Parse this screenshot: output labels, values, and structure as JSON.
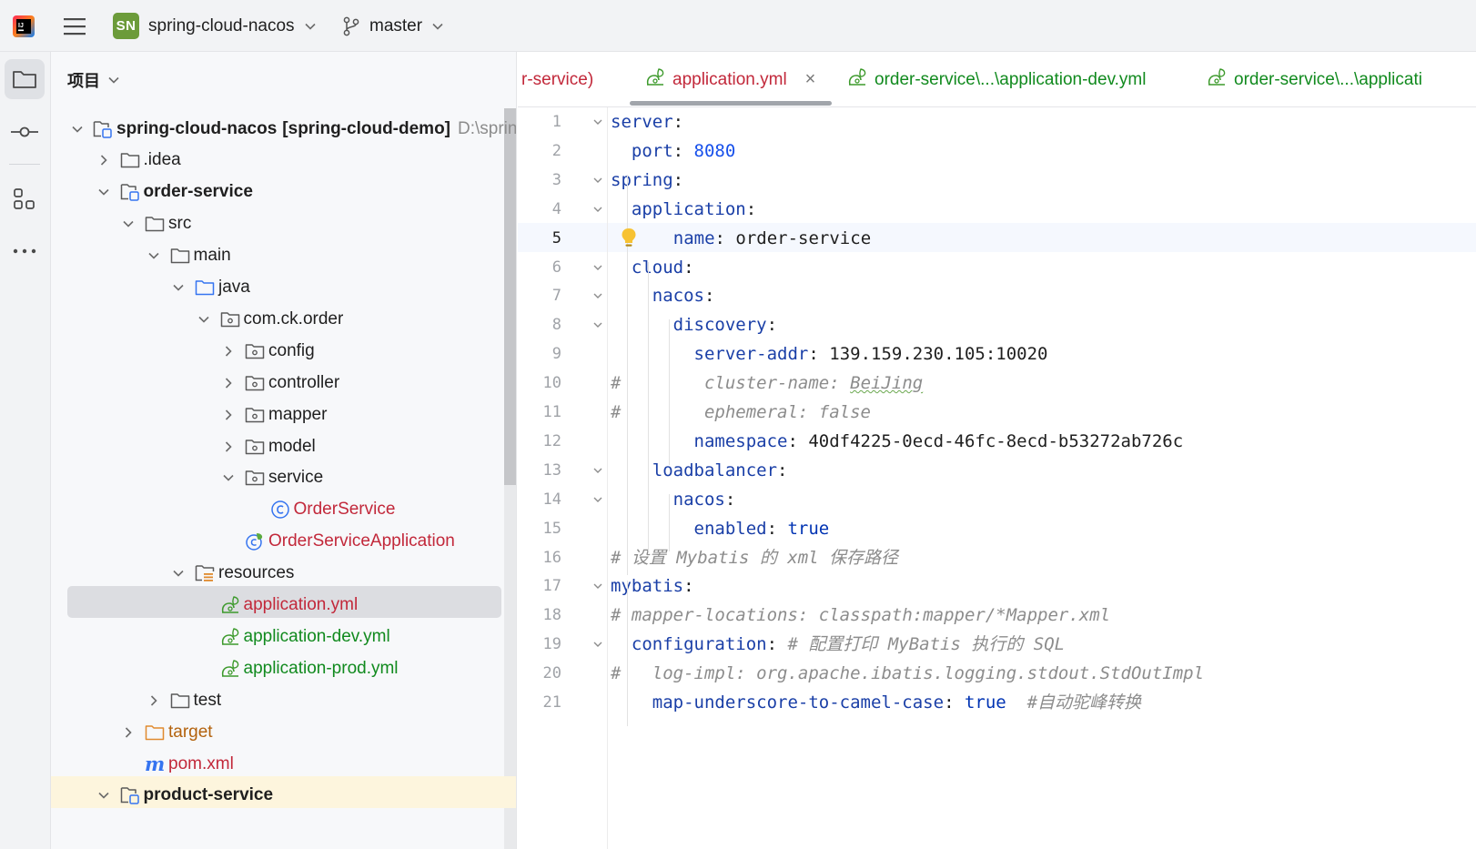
{
  "titlebar": {
    "project_avatar": "SN",
    "project_name": "spring-cloud-nacos",
    "branch": "master"
  },
  "panel": {
    "title": "项目"
  },
  "tree": [
    {
      "label": "spring-cloud-nacos",
      "extra": "[spring-cloud-demo]",
      "path": "D:\\spring",
      "bold": true
    },
    {
      "label": ".idea"
    },
    {
      "label": "order-service",
      "bold": true
    },
    {
      "label": "src"
    },
    {
      "label": "main"
    },
    {
      "label": "java"
    },
    {
      "label": "com.ck.order"
    },
    {
      "label": "config"
    },
    {
      "label": "controller"
    },
    {
      "label": "mapper"
    },
    {
      "label": "model"
    },
    {
      "label": "service"
    },
    {
      "label": "OrderService"
    },
    {
      "label": "OrderServiceApplication"
    },
    {
      "label": "resources"
    },
    {
      "label": "application.yml"
    },
    {
      "label": "application-dev.yml"
    },
    {
      "label": "application-prod.yml"
    },
    {
      "label": "test"
    },
    {
      "label": "target"
    },
    {
      "label": "pom.xml"
    },
    {
      "label": "product-service",
      "bold": true
    }
  ],
  "tabs": [
    {
      "label": "r-service)"
    },
    {
      "label": "application.yml",
      "active": true
    },
    {
      "label": "order-service\\...\\application-dev.yml"
    },
    {
      "label": "order-service\\...\\applicati"
    }
  ],
  "editor": {
    "current_line": 5,
    "lines": [
      {
        "n": "1",
        "key": "server",
        "sep": ":"
      },
      {
        "n": "2",
        "key": "port",
        "sep": ": ",
        "val": "8080"
      },
      {
        "n": "3",
        "key": "spring",
        "sep": ":"
      },
      {
        "n": "4",
        "key": "application",
        "sep": ":"
      },
      {
        "n": "5",
        "key": "name",
        "sep": ": ",
        "val": "order-service"
      },
      {
        "n": "6",
        "key": "cloud",
        "sep": ":"
      },
      {
        "n": "7",
        "key": "nacos",
        "sep": ":"
      },
      {
        "n": "8",
        "key": "discovery",
        "sep": ":"
      },
      {
        "n": "9",
        "key": "server-addr",
        "sep": ": ",
        "val": "139.159.230.105:10020"
      },
      {
        "n": "10",
        "hash": "#",
        "comment": "cluster-name: ",
        "comment2": "BeiJing"
      },
      {
        "n": "11",
        "hash": "#",
        "comment": "ephemeral: false"
      },
      {
        "n": "12",
        "key": "namespace",
        "sep": ": ",
        "val": "40df4225-0ecd-46fc-8ecd-b53272ab726c"
      },
      {
        "n": "13",
        "key": "loadbalancer",
        "sep": ":"
      },
      {
        "n": "14",
        "key": "nacos",
        "sep": ":"
      },
      {
        "n": "15",
        "key": "enabled",
        "sep": ": ",
        "val": "true"
      },
      {
        "n": "16",
        "comment": "# 设置 Mybatis 的 xml 保存路径"
      },
      {
        "n": "17",
        "key": "mybatis",
        "sep": ":"
      },
      {
        "n": "18",
        "hash": "#",
        "comment": "mapper-locations: classpath:mapper/*Mapper.xml"
      },
      {
        "n": "19",
        "key": "configuration",
        "sep": ": ",
        "comment": "# 配置打印 MyBatis 执行的 SQL"
      },
      {
        "n": "20",
        "hash": "#",
        "comment": "log-impl: org.apache.ibatis.logging.stdout.StdOutImpl"
      },
      {
        "n": "21",
        "key": "map-underscore-to-camel-case",
        "sep": ": ",
        "val": "true",
        "comment": "#自动驼峰转换"
      }
    ]
  }
}
